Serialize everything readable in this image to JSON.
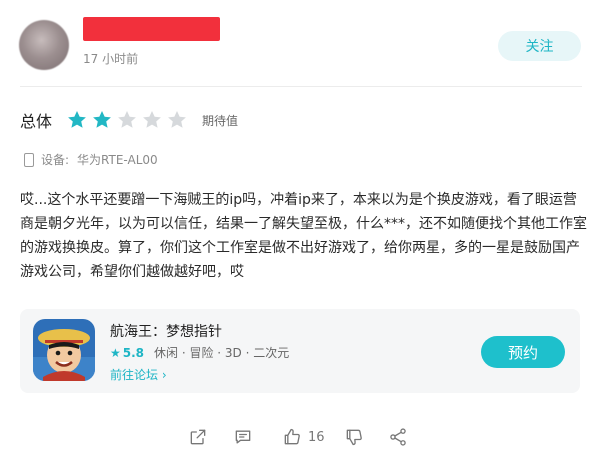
{
  "user": {
    "time": "17 小时前",
    "follow_label": "关注"
  },
  "rating": {
    "label": "总体",
    "stars_filled": 2,
    "stars_total": 5,
    "text": "期待值",
    "star_color": "#22b7c4"
  },
  "device": {
    "label": "设备:",
    "value": "华为RTE-AL00"
  },
  "review": {
    "text": "哎...这个水平还要蹭一下海贼王的ip吗，冲着ip来了，本来以为是个换皮游戏，看了眼运营商是朝夕光年，以为可以信任，结果一了解失望至极，什么***，还不如随便找个其他工作室的游戏换换皮。算了，你们这个工作室是做不出好游戏了，给你两星，多的一星是鼓励国产游戏公司，希望你们越做越好吧，哎"
  },
  "game": {
    "title": "航海王：梦想指针",
    "score": "5.8",
    "tags": "休闲 · 冒险 · 3D · 二次元",
    "forum_link": "前往论坛",
    "reserve_label": "预约",
    "accent_color": "#1ec0cc"
  },
  "actions": {
    "like_count": "16",
    "icons": [
      "share-out-icon",
      "comment-icon",
      "thumbs-up-icon",
      "thumbs-down-icon",
      "share-icon"
    ]
  }
}
